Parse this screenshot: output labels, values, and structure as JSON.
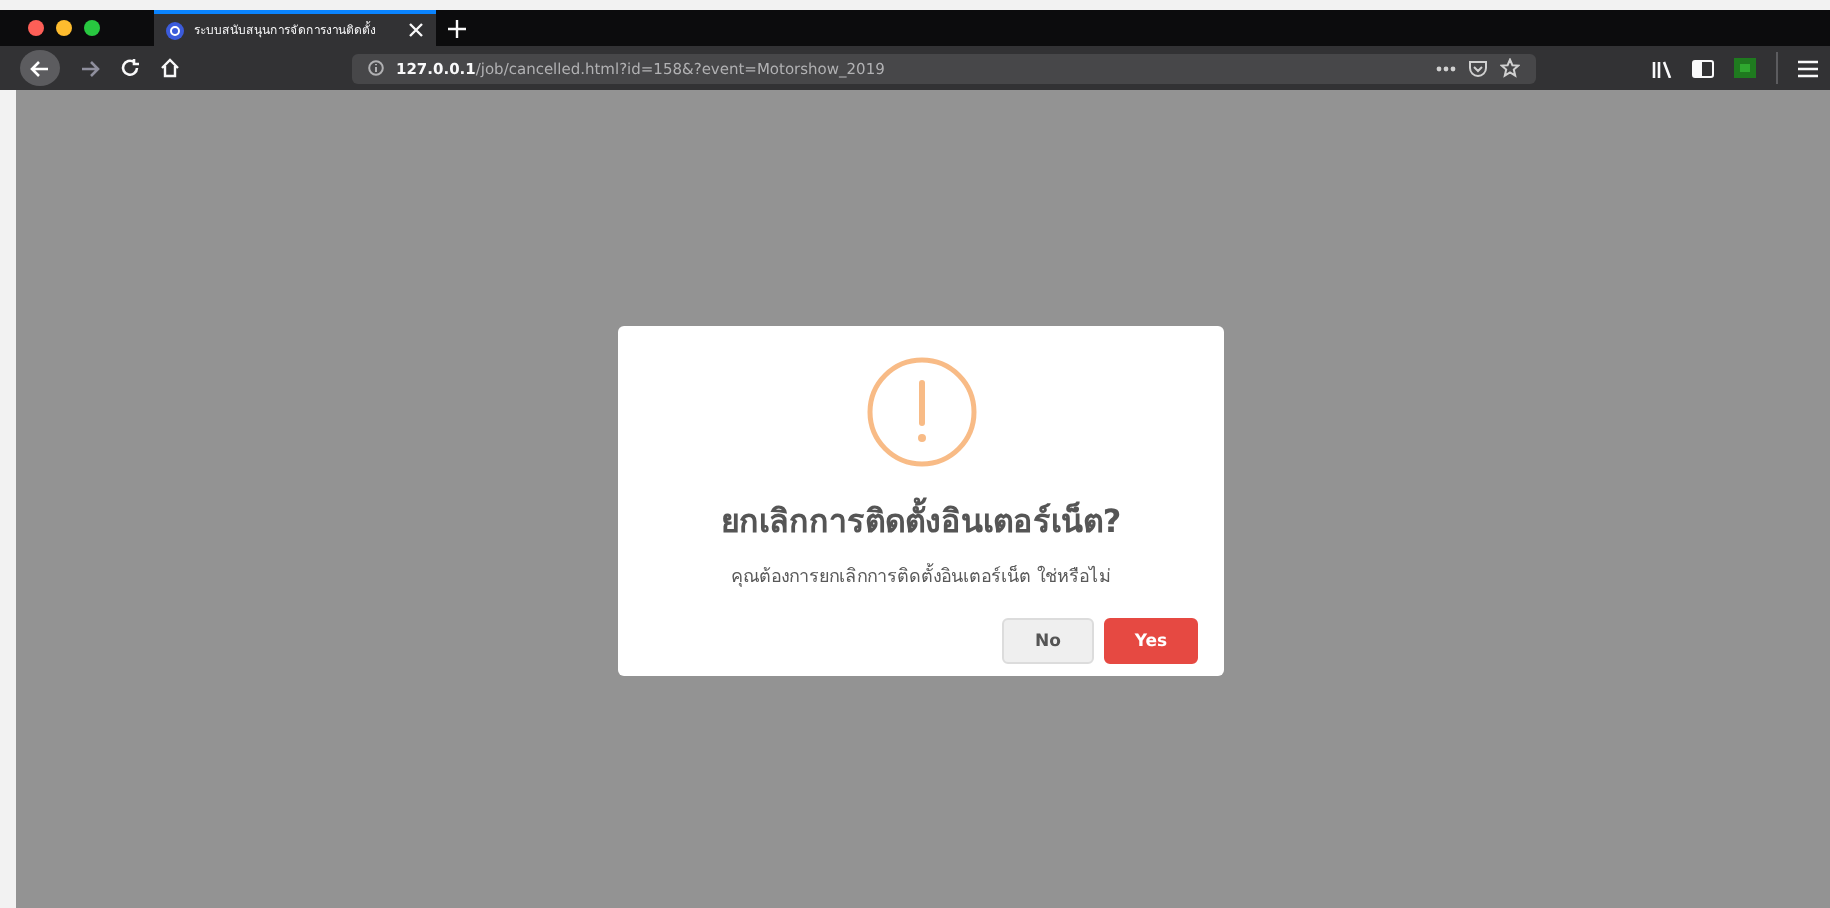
{
  "browser": {
    "tab": {
      "title": "ระบบสนับสนุนการจัดการงานติดตั้ง",
      "selected": true
    },
    "url": {
      "host": "127.0.0.1",
      "path": "/job/cancelled.html?id=158&?event=Motorshow_2019"
    }
  },
  "dialog": {
    "title": "ยกเลิกการติดตั้งอินเตอร์เน็ต?",
    "message": "คุณต้องการยกเลิกการติดตั้งอินเตอร์เน็ต ใช่หรือไม่",
    "buttons": [
      {
        "label": "No",
        "kind": "cancel"
      },
      {
        "label": "Yes",
        "kind": "confirm"
      }
    ]
  }
}
